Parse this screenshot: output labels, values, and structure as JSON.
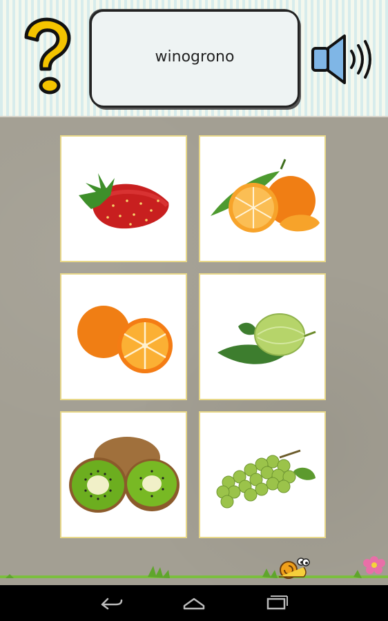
{
  "header": {
    "word": "winogrono",
    "help_icon": "question-mark-icon",
    "sound_icon": "speaker-icon"
  },
  "tiles": [
    {
      "name": "strawberry"
    },
    {
      "name": "tangerine"
    },
    {
      "name": "orange"
    },
    {
      "name": "gooseberry"
    },
    {
      "name": "kiwi"
    },
    {
      "name": "grapes"
    }
  ],
  "navbar": {
    "icons": [
      "back-icon",
      "home-icon",
      "recent-apps-icon"
    ]
  },
  "colors": {
    "header_stripe_a": "#d7ecec",
    "header_stripe_b": "#f4f8ee",
    "question_mark": "#f4c400",
    "speaker": "#7fb6e6",
    "tile_border": "#e8d889",
    "background": "#a39f93"
  }
}
